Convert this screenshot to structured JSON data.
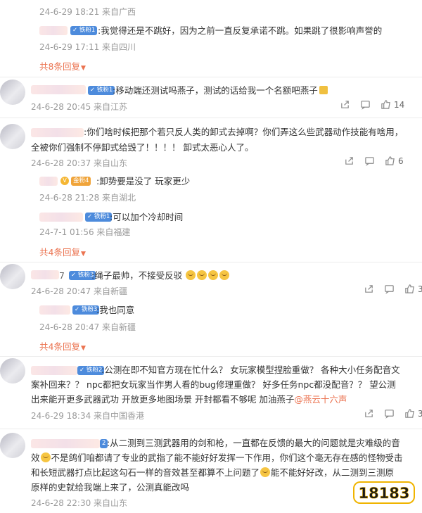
{
  "items": {
    "top_meta": "24-6-29 18:21 来自广西",
    "r0_badge": "✓ 铁粉1",
    "r0_text": "我觉得还是不跳好，因为之前一直反复承诺不跳。如果跳了很影响声誉的",
    "r0_meta": "24-6-29 17:11 来自四川",
    "more1": "共8条回复",
    "c1_badge": "✓ 铁粉1",
    "c1_text": "移动端还测试吗燕子，测试的话给我一个名额吧燕子",
    "c1_meta": "24-6-28 20:45 来自江苏",
    "c1_likes": "14",
    "c2_text_1": "你们啥时候把那个若只反人类的卸式去掉啊？你们弄这么些武器动作技能有啥用，",
    "c2_text_2": "全被你们强制不停卸式给毁了！！！！ 卸式太恶心人了。",
    "c2_meta": "24-6-28 20:37 来自山东",
    "c2_likes": "6",
    "r2a_badge": "金粉4",
    "r2a_text": "卸势要是没了 玩家更少",
    "r2a_meta": "24-6-28 21:28 来自湖北",
    "r2b_badge": "✓ 铁粉1",
    "r2b_text": "可以加个冷却时间",
    "r2b_meta": "24-7-1 01:56 来自福建",
    "more2": "共4条回复",
    "c3_name_tail": "7",
    "c3_badge": "✓ 铁粉3",
    "c3_text": "绳子最帅，不接受反驳",
    "c3_meta": "24-6-28 20:47 来自新疆",
    "c3_likes": "3",
    "r3_badge": "✓ 铁粉3",
    "r3_text": "我也同意",
    "r3_meta": "24-6-28 20:47 来自新疆",
    "more3": "共4条回复",
    "c4_badge": "✓ 铁粉2",
    "c4_text_1": "公测在即不知官方现在忙什么？ 女玩家模型捏脸重做？ 各种大小任务配音文",
    "c4_text_2": "案补回来？？ npc都把女玩家当作男人看的bug修理重做？ 好多任务npc都没配音？？ 望公测",
    "c4_text_3": "出来能开更多武器武功 开放更多地图场景 开封都看不够呢 加油燕子",
    "c4_mention": "@燕云十六声",
    "c4_meta": "24-6-29 18:34 来自中国香港",
    "c4_likes": "3",
    "c5_badge": "2",
    "c5_text_1": "从二测到三测武器用的剑和枪，一直都在反馈的最大的问题就是灾难级的音",
    "c5_text_2a": "效",
    "c5_text_2b": "不是鸽们咱都请了专业的武指了能不能好好发挥一下作用，你们这个毫无存在感的怪物受击",
    "c5_text_3a": "和长短武器打点比起这勾石一样的音效甚至都算不上问题了",
    "c5_text_3b": "能不能好好改，从二测到三测原",
    "c5_text_4": "原样的史就给我端上来了，公测真能改吗",
    "c5_meta": "24-6-28 22:30 来自山东",
    "watermark": "18183"
  },
  "colors": {
    "link": "#eb7350",
    "badge": "#4d8bdc",
    "meta": "#9a9a9a"
  },
  "icons": [
    "share-icon",
    "comment-icon",
    "like-icon",
    "emoji-icon"
  ]
}
